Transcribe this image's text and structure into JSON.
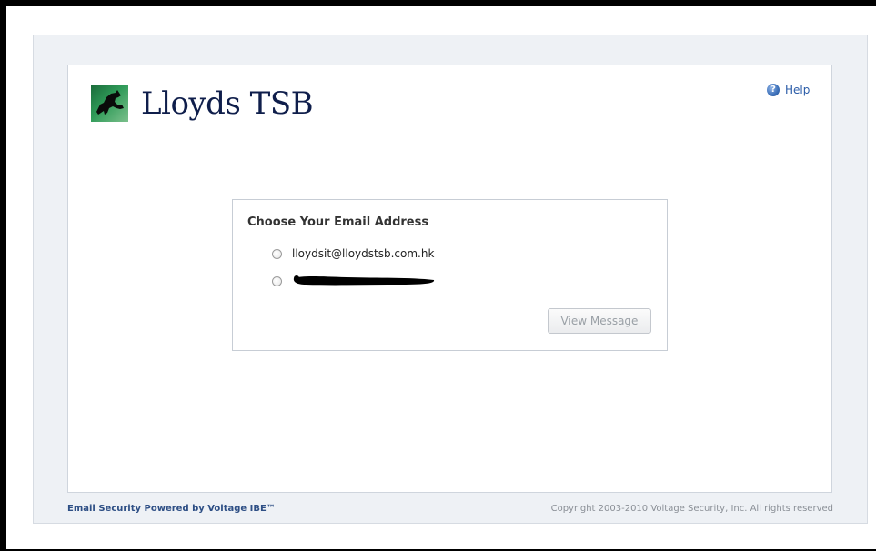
{
  "brand": {
    "name": "Lloyds TSB",
    "logo_icon": "black-horse-logo-icon",
    "text_color": "#0f1e4b"
  },
  "header": {
    "help_label": "Help",
    "help_icon": "help-icon"
  },
  "email_chooser": {
    "title": "Choose Your Email Address",
    "options": [
      {
        "label": "lloydsit@lloydstsb.com.hk",
        "selected": false
      },
      {
        "label": "",
        "selected": false,
        "redacted": true
      }
    ],
    "submit_label": "View Message",
    "submit_enabled": false
  },
  "footer": {
    "powered_by": "Email Security Powered by Voltage IBE™",
    "copyright": "Copyright 2003-2010 Voltage Security, Inc. All rights reserved"
  },
  "colors": {
    "link": "#2b5ca8",
    "panel_bg": "#eef1f5",
    "button_text_disabled": "#9aa0a6"
  }
}
